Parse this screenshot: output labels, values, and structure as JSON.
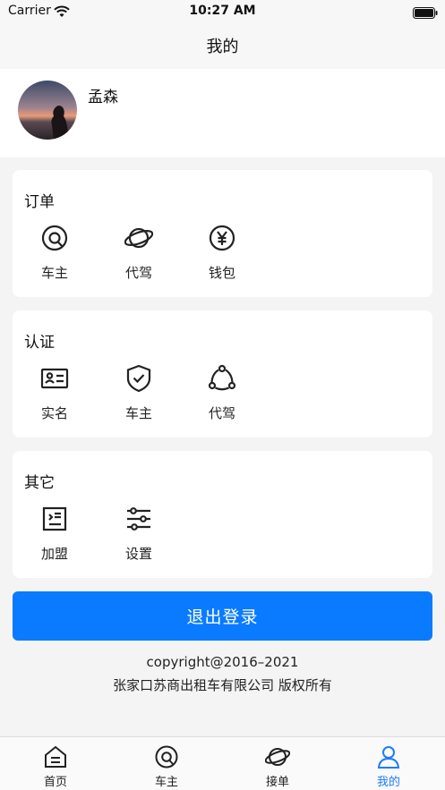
{
  "status_bar": {
    "carrier": "Carrier",
    "time": "10:27 AM",
    "wifi_icon": "wifi-icon",
    "battery_icon": "battery-icon"
  },
  "nav": {
    "title": "我的"
  },
  "profile": {
    "name": "孟森",
    "avatar": "user-avatar-photo"
  },
  "sections": [
    {
      "title": "订单",
      "items": [
        {
          "label": "车主",
          "icon": "steering-wheel-icon"
        },
        {
          "label": "代驾",
          "icon": "planet-icon"
        },
        {
          "label": "钱包",
          "icon": "yen-coin-icon"
        }
      ]
    },
    {
      "title": "认证",
      "items": [
        {
          "label": "实名",
          "icon": "id-card-icon"
        },
        {
          "label": "车主",
          "icon": "shield-check-icon"
        },
        {
          "label": "代驾",
          "icon": "share-nodes-icon"
        }
      ]
    },
    {
      "title": "其它",
      "items": [
        {
          "label": "加盟",
          "icon": "list-box-icon"
        },
        {
          "label": "设置",
          "icon": "sliders-icon"
        }
      ]
    }
  ],
  "logout": {
    "label": "退出登录"
  },
  "footer": {
    "copyright": "copyright@2016–2021",
    "company": "张家口苏商出租车有限公司 版权所有"
  },
  "tabs": [
    {
      "label": "首页",
      "icon": "home-icon",
      "active": false
    },
    {
      "label": "车主",
      "icon": "steering-wheel-icon",
      "active": false
    },
    {
      "label": "接单",
      "icon": "planet-icon",
      "active": false
    },
    {
      "label": "我的",
      "icon": "person-icon",
      "active": true
    }
  ],
  "colors": {
    "accent": "#0a7bff",
    "active_tab": "#1e7bff",
    "background": "#f4f4f4",
    "card": "#ffffff"
  }
}
